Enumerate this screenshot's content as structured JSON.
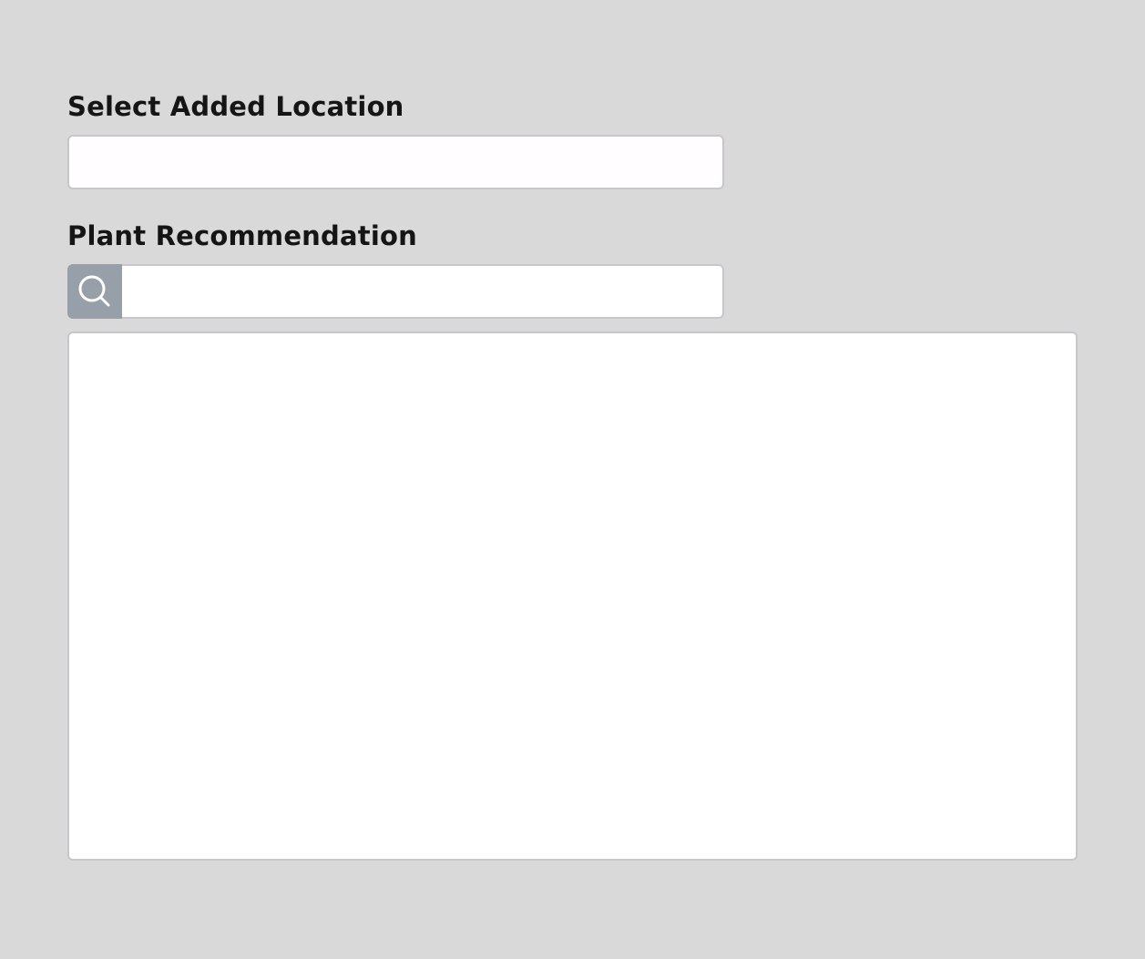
{
  "location": {
    "label": "Select Added Location",
    "selected_value": ""
  },
  "plant": {
    "label": "Plant Recommendation",
    "search_value": "",
    "search_icon": "search-icon",
    "results": []
  }
}
